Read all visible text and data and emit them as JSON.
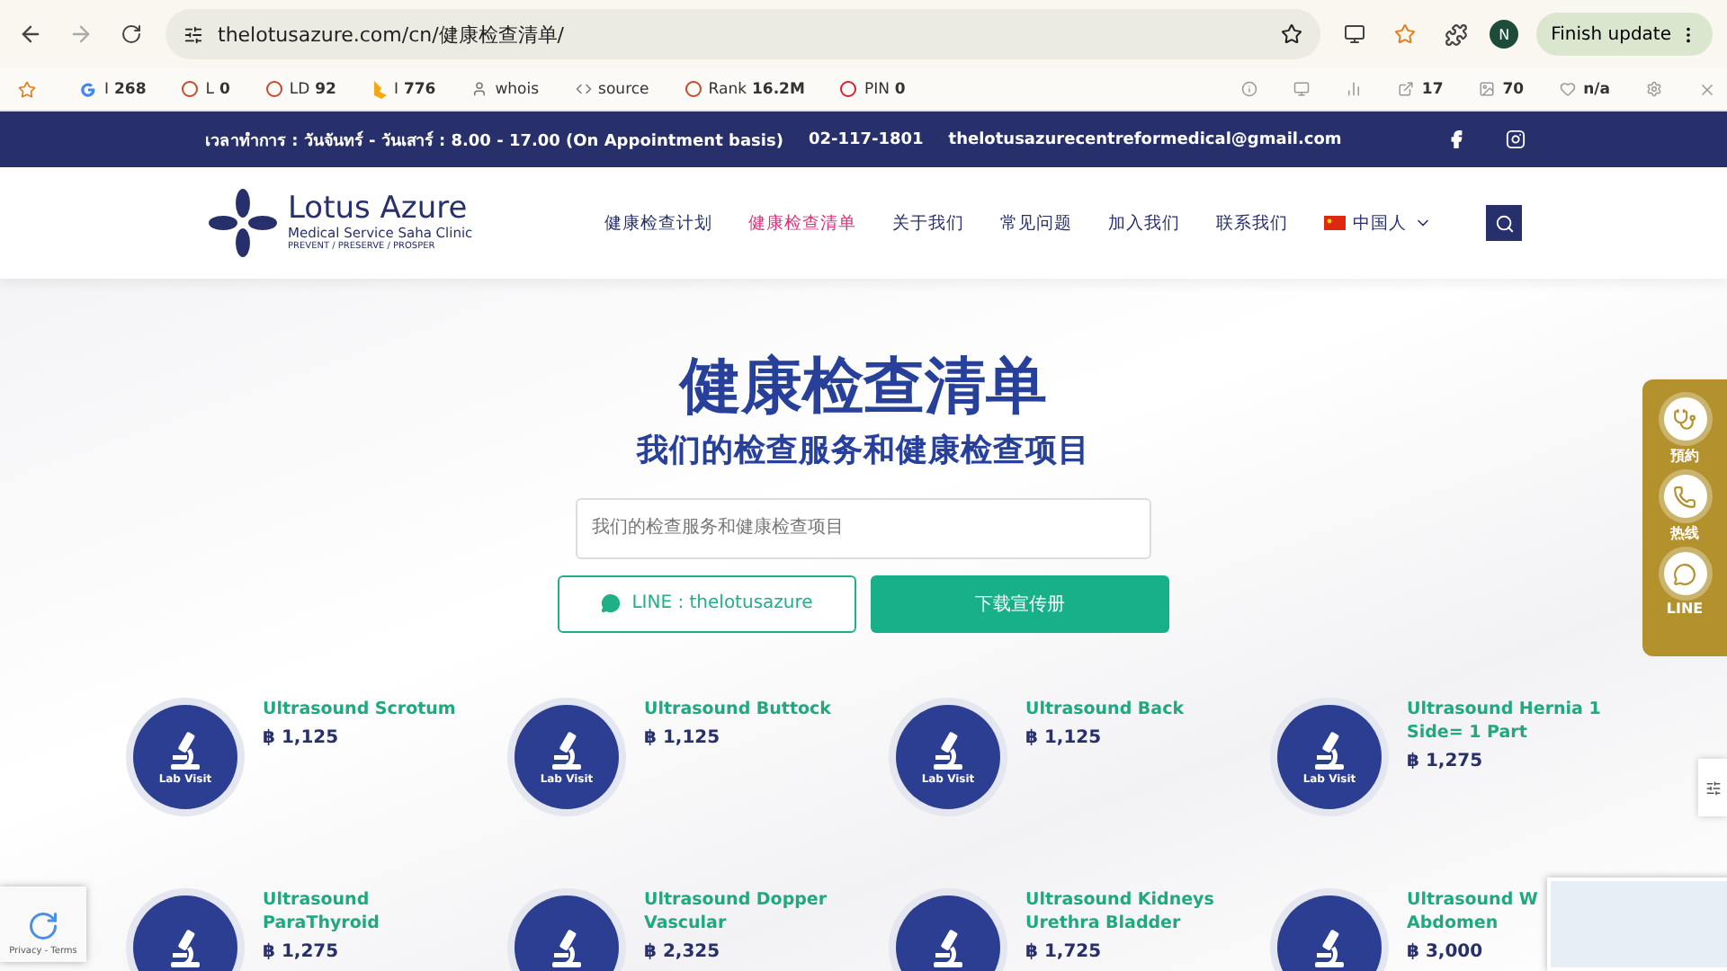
{
  "browser": {
    "url": "thelotusazure.com/cn/健康检查清单/",
    "profile": "N",
    "update_button": "Finish update"
  },
  "seo_bar": {
    "items": [
      {
        "kind": "google",
        "label": "I",
        "value": "268"
      },
      {
        "kind": "ring",
        "label": "L",
        "value": "0"
      },
      {
        "kind": "ring",
        "label": "LD",
        "value": "92"
      },
      {
        "kind": "bing",
        "label": "I",
        "value": "776"
      },
      {
        "kind": "person",
        "label": "whois"
      },
      {
        "kind": "code",
        "label": "source"
      },
      {
        "kind": "ring",
        "label": "Rank",
        "value": "16.2M"
      },
      {
        "kind": "pin",
        "label": "PIN",
        "value": "0"
      }
    ],
    "right": [
      {
        "kind": "info"
      },
      {
        "kind": "screen"
      },
      {
        "kind": "chart"
      },
      {
        "kind": "link",
        "value": "17"
      },
      {
        "kind": "image",
        "value": "70"
      },
      {
        "kind": "heart",
        "value": "n/a"
      }
    ]
  },
  "topbar": {
    "hours": "เวลาทำการ : วันจันทร์ - วันเสาร์ : 8.00 - 17.00 (On Appointment basis)",
    "phone": "02-117-1801",
    "email": "thelotusazurecentreformedical@gmail.com"
  },
  "logo": {
    "name": "Lotus Azure",
    "tagline": "Medical Service Saha Clinic",
    "motto": "PREVENT / PRESERVE / PROSPER"
  },
  "nav": [
    {
      "label": "健康检查计划",
      "selected": false
    },
    {
      "label": "健康检查清单",
      "selected": true
    },
    {
      "label": "关于我们",
      "selected": false
    },
    {
      "label": "常见问题",
      "selected": false
    },
    {
      "label": "加入我们",
      "selected": false
    },
    {
      "label": "联系我们",
      "selected": false
    }
  ],
  "language": "中国人",
  "hero": {
    "title": "健康检查清单",
    "subtitle": "我们的检查服务和健康检查项目",
    "search_placeholder": "我们的检查服务和健康检查项目",
    "line_button": "LINE : thelotusazure",
    "download_button": "下载宣传册"
  },
  "side_panel": [
    {
      "kind": "stethoscope",
      "label": "預約"
    },
    {
      "kind": "phone",
      "label": "热线"
    },
    {
      "kind": "line",
      "label": "LINE"
    }
  ],
  "items": [
    {
      "badge": "Lab Visit",
      "name": "Ultrasound Scrotum",
      "price": "฿ 1,125"
    },
    {
      "badge": "Lab Visit",
      "name": "Ultrasound Buttock",
      "price": "฿ 1,125"
    },
    {
      "badge": "Lab Visit",
      "name": "Ultrasound Back",
      "price": "฿ 1,125"
    },
    {
      "badge": "Lab Visit",
      "name": "Ultrasound Hernia 1 Side= 1 Part",
      "price": "฿ 1,275"
    },
    {
      "name": "Ultrasound ParaThyroid",
      "price": "฿ 1,275"
    },
    {
      "name": "Ultrasound Dopper Vascular",
      "price": "฿ 2,325"
    },
    {
      "name": "Ultrasound Kidneys Urethra Bladder",
      "price": "฿ 1,725"
    },
    {
      "name": "Ultrasound W\nAbdomen",
      "price": "฿ 3,000"
    }
  ],
  "recaptcha": "Privacy - Terms"
}
